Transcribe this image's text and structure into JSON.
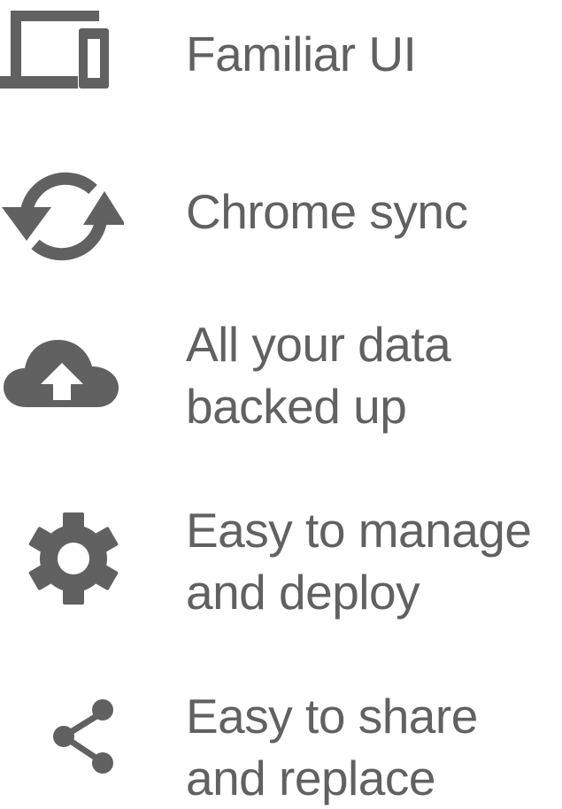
{
  "colors": {
    "icon": "#616161",
    "text": "#616161",
    "background": "#ffffff"
  },
  "features": [
    {
      "icon": "devices-icon",
      "lines": [
        "Familiar UI"
      ]
    },
    {
      "icon": "sync-icon",
      "lines": [
        "Chrome sync"
      ]
    },
    {
      "icon": "cloud-upload-icon",
      "lines": [
        "All your data",
        "backed up"
      ]
    },
    {
      "icon": "gear-icon",
      "lines": [
        "Easy to manage",
        "and deploy"
      ]
    },
    {
      "icon": "share-icon",
      "lines": [
        "Easy to share",
        "and replace"
      ]
    }
  ]
}
